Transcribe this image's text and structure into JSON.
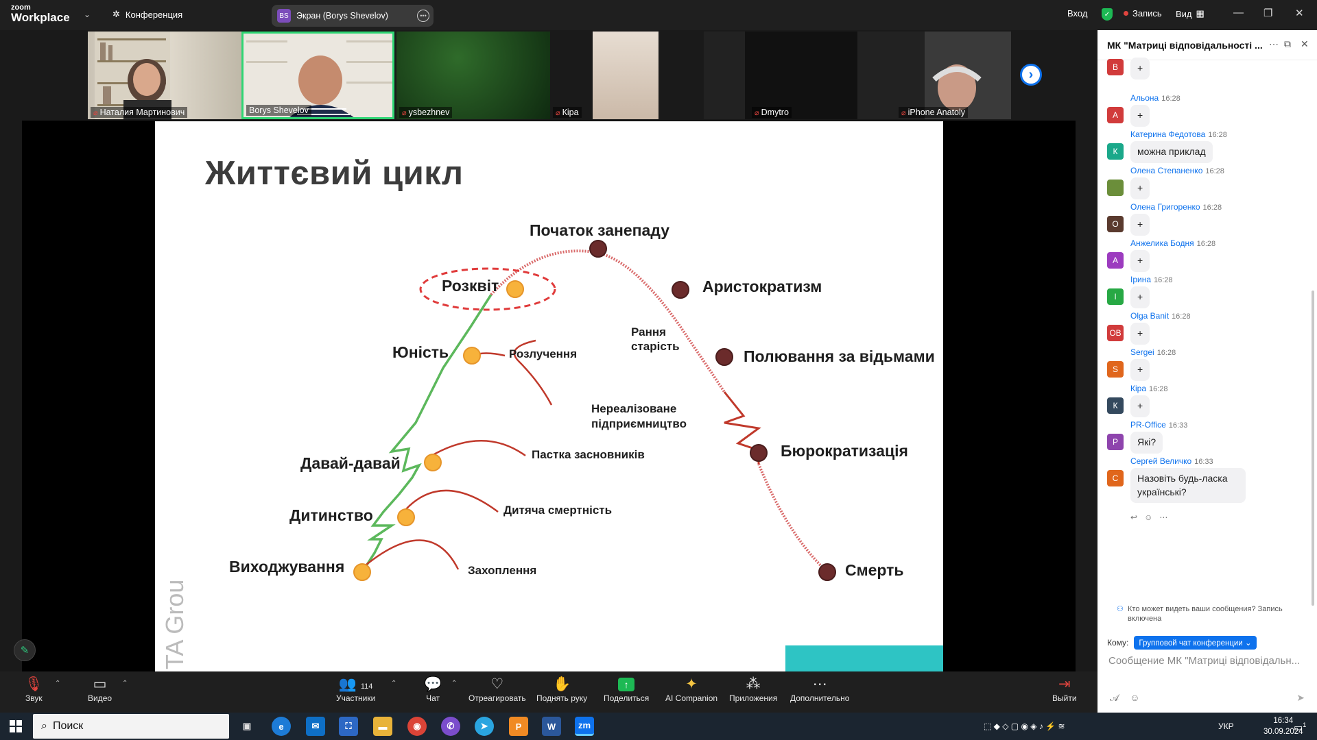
{
  "app": {
    "logo_small": "zoom",
    "logo_big": "Workplace",
    "conference_label": "Конференция"
  },
  "screen_share": {
    "initials": "BS",
    "label": "Экран (Borys Shevelov)"
  },
  "top_right": {
    "login": "Вход",
    "record": "Запись",
    "view": "Вид"
  },
  "participants_strip": [
    {
      "name": "Наталия Мартинович",
      "muted": true
    },
    {
      "name": "Borys Shevelov",
      "muted": false
    },
    {
      "name": "ysbezhnev",
      "muted": true
    },
    {
      "name": "Кіра",
      "muted": true
    },
    {
      "name": "Dmytro",
      "muted": true
    },
    {
      "name": "iPhone Anatoly",
      "muted": true
    }
  ],
  "slide": {
    "title": "Життєвий цикл",
    "stages": {
      "vykhodzhuvannia": "Виходжування",
      "dytynstvo": "Дитинство",
      "davai": "Давай-давай",
      "yunist": "Юність",
      "rozkvit": "Розквіт",
      "pochatok": "Початок занепаду",
      "arystokratyzm": "Аристократизм",
      "poliuvannia": "Полювання за відьмами",
      "biurokratyzatsiia": "Бюрократизація",
      "smert": "Смерть"
    },
    "traps": {
      "zakhoplennia": "Захоплення",
      "dytiacha": "Дитяча смертність",
      "pastka": "Пастка засновників",
      "rozluchennia": "Розлучення",
      "rannia_1": "Рання",
      "rannia_2": "старість",
      "nerealiz_1": "Нереалізоване",
      "nerealiz_2": "підприємництво"
    },
    "watermark": "TA Grou"
  },
  "toolbar": {
    "audio": "Звук",
    "video": "Видео",
    "participants": "Участники",
    "participants_count": "114",
    "chat": "Чат",
    "react": "Отреагировать",
    "raise_hand": "Поднять руку",
    "share": "Поделиться",
    "ai": "AI Companion",
    "apps": "Приложения",
    "more": "Дополнительно",
    "leave": "Выйти"
  },
  "chat": {
    "title": "МК \"Матриці відповідальності ...",
    "first_plus": "+",
    "messages": [
      {
        "initial": "А",
        "color": "#d13b3b",
        "name": "Альона",
        "time": "16:28",
        "text": "+"
      },
      {
        "initial": "К",
        "color": "#1aa88a",
        "name": "Катерина Федотова",
        "time": "16:28",
        "text": "можна приклад"
      },
      {
        "initial": "",
        "color": "#6b8e3a",
        "name": "Олена Степаненко",
        "time": "16:28",
        "text": "+"
      },
      {
        "initial": "О",
        "color": "#5a3a2e",
        "name": "Олена Григоренко",
        "time": "16:28",
        "text": "+"
      },
      {
        "initial": "А",
        "color": "#9c3bbf",
        "name": "Анжелика Бодня",
        "time": "16:28",
        "text": "+"
      },
      {
        "initial": "І",
        "color": "#27a844",
        "name": "Ірина",
        "time": "16:28",
        "text": "+"
      },
      {
        "initial": "OB",
        "color": "#d13b3b",
        "name": "Olga Banit",
        "time": "16:28",
        "text": "+"
      },
      {
        "initial": "S",
        "color": "#e0661c",
        "name": "Sergei",
        "time": "16:28",
        "text": "+"
      },
      {
        "initial": "К",
        "color": "#34495e",
        "name": "Кіра",
        "time": "16:28",
        "text": "+"
      },
      {
        "initial": "P",
        "color": "#8e44ad",
        "name": "PR-Office",
        "time": "16:33",
        "text": "Які?"
      },
      {
        "initial": "С",
        "color": "#e0661c",
        "name": "Сергей Величко",
        "time": "16:33",
        "text": "Назовіть будь-ласка українські?"
      }
    ],
    "visibility_note": "Кто может видеть ваши сообщения? Запись включена",
    "to_label": "Кому:",
    "to_value": "Групповой чат конференции ⌄",
    "composer_placeholder": "Сообщение МК \"Матриці відповідальн..."
  },
  "taskbar": {
    "search": "Поиск",
    "lang": "УКР",
    "time": "16:34",
    "date": "30.09.2024",
    "notif": "1"
  }
}
